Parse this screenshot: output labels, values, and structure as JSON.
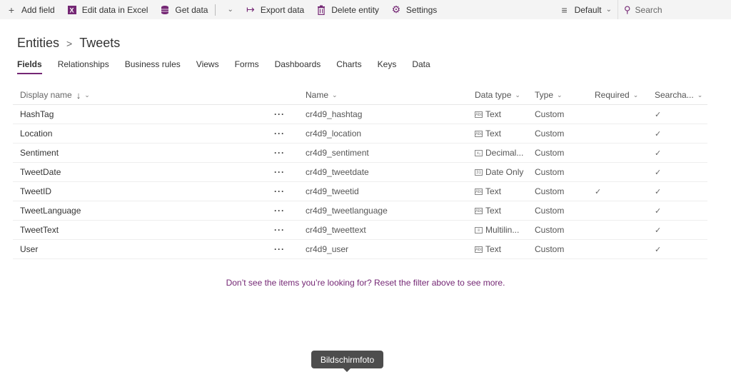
{
  "toolbar": {
    "add_field": "Add field",
    "edit_excel": "Edit data in Excel",
    "get_data": "Get data",
    "export_data": "Export data",
    "delete_entity": "Delete entity",
    "settings": "Settings",
    "view_selector": "Default",
    "search_placeholder": "Search"
  },
  "breadcrumb": {
    "parent": "Entities",
    "current": "Tweets"
  },
  "tabs": [
    "Fields",
    "Relationships",
    "Business rules",
    "Views",
    "Forms",
    "Dashboards",
    "Charts",
    "Keys",
    "Data"
  ],
  "columns": {
    "display_name": "Display name",
    "name": "Name",
    "data_type": "Data type",
    "type": "Type",
    "required": "Required",
    "searchable": "Searcha..."
  },
  "rows": [
    {
      "display": "HashTag",
      "name": "cr4d9_hashtag",
      "dtype": "Text",
      "dicon": "text-icon",
      "type": "Custom",
      "required": "",
      "searchable": "✓"
    },
    {
      "display": "Location",
      "name": "cr4d9_location",
      "dtype": "Text",
      "dicon": "text-icon",
      "type": "Custom",
      "required": "",
      "searchable": "✓"
    },
    {
      "display": "Sentiment",
      "name": "cr4d9_sentiment",
      "dtype": "Decimal...",
      "dicon": "decimal-icon",
      "type": "Custom",
      "required": "",
      "searchable": "✓"
    },
    {
      "display": "TweetDate",
      "name": "cr4d9_tweetdate",
      "dtype": "Date Only",
      "dicon": "calendar-icon",
      "type": "Custom",
      "required": "",
      "searchable": "✓"
    },
    {
      "display": "TweetID",
      "name": "cr4d9_tweetid",
      "dtype": "Text",
      "dicon": "text-icon",
      "type": "Custom",
      "required": "✓",
      "searchable": "✓"
    },
    {
      "display": "TweetLanguage",
      "name": "cr4d9_tweetlanguage",
      "dtype": "Text",
      "dicon": "text-icon",
      "type": "Custom",
      "required": "",
      "searchable": "✓"
    },
    {
      "display": "TweetText",
      "name": "cr4d9_tweettext",
      "dtype": "Multilin...",
      "dicon": "multiline-icon",
      "type": "Custom",
      "required": "",
      "searchable": "✓"
    },
    {
      "display": "User",
      "name": "cr4d9_user",
      "dtype": "Text",
      "dicon": "text-icon",
      "type": "Custom",
      "required": "",
      "searchable": "✓"
    }
  ],
  "row_menu": "···",
  "notice": "Don’t see the items you’re looking for? Reset the filter above to see more.",
  "tooltip": "Bildschirmfoto",
  "accent_color": "#742774"
}
